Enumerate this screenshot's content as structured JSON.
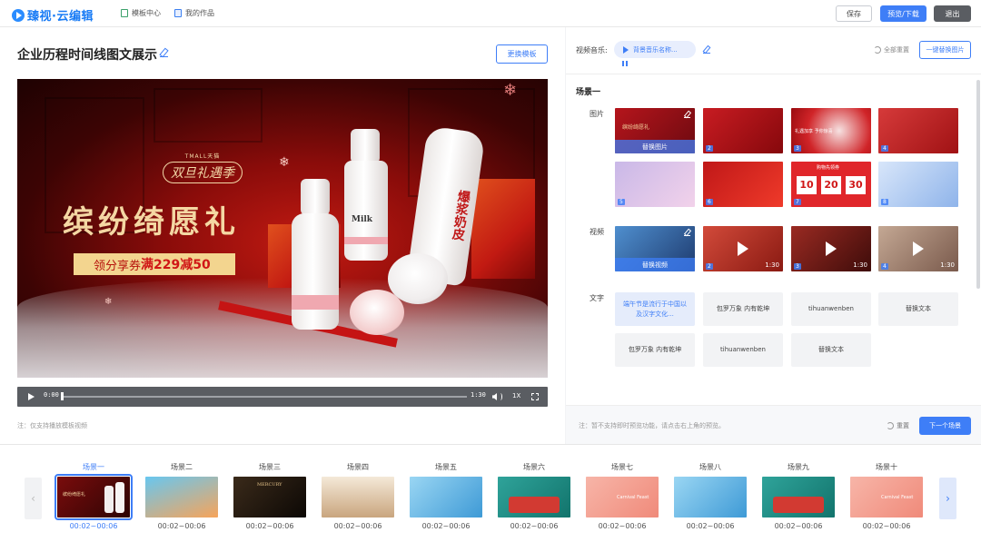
{
  "colors": {
    "accent": "#3e7ef7",
    "exit": "#5a5d62",
    "video_red": "#c21a12",
    "gold": "#f4d7a3"
  },
  "header": {
    "logo_text": "臻视·云编辑",
    "nav": [
      {
        "label": "模板中心",
        "icon": "template-icon"
      },
      {
        "label": "我的作品",
        "icon": "works-icon"
      }
    ],
    "save_label": "保存",
    "preview_label": "预览/下载",
    "exit_label": "退出"
  },
  "editor": {
    "title": "企业历程时间线图文展示",
    "change_template_label": "更换模板",
    "video": {
      "brand_small": "TMALL天猫",
      "brand_script": "双旦礼遇季",
      "headline": "缤纷绮愿礼",
      "coupon_prefix": "领分享券",
      "coupon_highlight": "满229减50",
      "product_label_1": "Milk",
      "product_label_2": "Milk",
      "product_label_3": "爆浆奶皮"
    },
    "player": {
      "current_time": "0:00",
      "duration": "1:30",
      "speed": "1X"
    },
    "note": "注：仅支持播放模板视频"
  },
  "panel": {
    "music_label": "视频音乐:",
    "music_name": "背景音乐名称...",
    "reset_all_label": "全部重置",
    "replace_images_label": "一键替换图片",
    "scene_title": "场景一",
    "images_label": "图片",
    "videos_label": "视频",
    "text_label": "文字",
    "images": [
      {
        "num": "1",
        "overlay": "替换图片"
      },
      {
        "num": "2",
        "overlay": ""
      },
      {
        "num": "3",
        "overlay": ""
      },
      {
        "num": "4",
        "overlay": ""
      },
      {
        "num": "5",
        "overlay": ""
      },
      {
        "num": "6",
        "overlay": ""
      },
      {
        "num": "7",
        "overlay": ""
      },
      {
        "num": "8",
        "overlay": ""
      }
    ],
    "image_texts": {
      "t3": "礼遇加享 予你惊喜",
      "t7": "购物先领券",
      "t7a": "10",
      "t7b": "20",
      "t7c": "30"
    },
    "videos": [
      {
        "num": "1",
        "overlay": "替换视频",
        "duration": ""
      },
      {
        "num": "2",
        "overlay": "",
        "duration": "1:30"
      },
      {
        "num": "3",
        "overlay": "",
        "duration": "1:30"
      },
      {
        "num": "4",
        "overlay": "",
        "duration": "1:30"
      }
    ],
    "texts": [
      "端午节是流行于中国以及汉字文化...",
      "包罗万象 内有乾坤",
      "tihuanwenben",
      "替换文本",
      "包罗万象 内有乾坤",
      "tihuanwenben",
      "替换文本"
    ],
    "footer_note": "注：暂不支持即时预览功能，请点击右上角的预览。",
    "reset_label": "重置",
    "next_scene_label": "下一个场景"
  },
  "scenes": [
    {
      "name": "场景一",
      "time": "00:02~00:06",
      "active": true
    },
    {
      "name": "场景二",
      "time": "00:02~00:06"
    },
    {
      "name": "场景三",
      "time": "00:02~00:06"
    },
    {
      "name": "场景四",
      "time": "00:02~00:06"
    },
    {
      "name": "场景五",
      "time": "00:02~00:06"
    },
    {
      "name": "场景六",
      "time": "00:02~00:06"
    },
    {
      "name": "场景七",
      "time": "00:02~00:06"
    },
    {
      "name": "场景八",
      "time": "00:02~00:06"
    },
    {
      "name": "场景九",
      "time": "00:02~00:06"
    },
    {
      "name": "场景十",
      "time": "00:02~00:06"
    }
  ],
  "scene_thumb_texts": {
    "s1": "缤纷绮愿礼",
    "s3": "MERCURY",
    "s7": "Carnival Feast",
    "s10": "Carnival Feast"
  }
}
